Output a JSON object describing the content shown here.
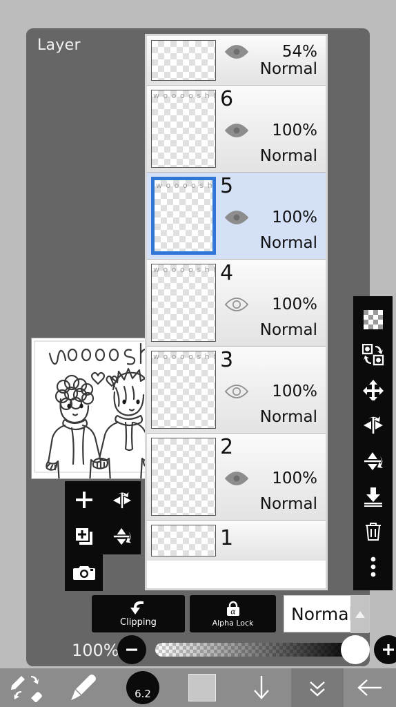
{
  "app": {
    "panel_title": "Layer"
  },
  "artwork": {
    "caption_text": "woooshh",
    "thumb_caption": "w o o o o s h h"
  },
  "layers": [
    {
      "name": "",
      "opacity": "54%",
      "blend": "Normal",
      "visible": true,
      "selected": false,
      "thumb_text": "",
      "partial": "top"
    },
    {
      "name": "6",
      "opacity": "100%",
      "blend": "Normal",
      "visible": true,
      "selected": false,
      "thumb_text": "w o o o o s h h",
      "partial": ""
    },
    {
      "name": "5",
      "opacity": "100%",
      "blend": "Normal",
      "visible": true,
      "selected": true,
      "thumb_text": "w o o o o s h h",
      "partial": ""
    },
    {
      "name": "4",
      "opacity": "100%",
      "blend": "Normal",
      "visible": false,
      "selected": false,
      "thumb_text": "w o o o o s h h",
      "partial": ""
    },
    {
      "name": "3",
      "opacity": "100%",
      "blend": "Normal",
      "visible": false,
      "selected": false,
      "thumb_text": "w o o o o s h h",
      "partial": ""
    },
    {
      "name": "2",
      "opacity": "100%",
      "blend": "Normal",
      "visible": true,
      "selected": false,
      "thumb_text": "",
      "partial": ""
    },
    {
      "name": "1",
      "opacity": "",
      "blend": "",
      "visible": true,
      "selected": false,
      "thumb_text": "",
      "partial": "bottom"
    }
  ],
  "right_toolbar": [
    {
      "icon": "transparency-checker-icon",
      "label": "Transparency"
    },
    {
      "icon": "swap-layers-icon",
      "label": "Swap Layers"
    },
    {
      "icon": "move-icon",
      "label": "Move"
    },
    {
      "icon": "flip-horizontal-icon",
      "label": "Flip Horizontal"
    },
    {
      "icon": "flip-vertical-icon",
      "label": "Flip Vertical"
    },
    {
      "icon": "merge-down-icon",
      "label": "Merge Down"
    },
    {
      "icon": "trash-icon",
      "label": "Delete Layer"
    },
    {
      "icon": "more-options-icon",
      "label": "More"
    }
  ],
  "popup_toolbar": [
    {
      "icon": "add-layer-icon",
      "label": "Add Layer"
    },
    {
      "icon": "flip-horizontal-icon",
      "label": "Flip Horizontal"
    },
    {
      "icon": "duplicate-layer-icon",
      "label": "Duplicate Layer"
    },
    {
      "icon": "flip-vertical-icon",
      "label": "Flip Vertical"
    },
    {
      "icon": "camera-icon",
      "label": "Import Photo"
    }
  ],
  "controls": {
    "clipping_label": "Clipping",
    "alpha_lock_label": "Alpha Lock",
    "blend_mode": "Normal",
    "blend_arrow": "up-arrow-icon"
  },
  "opacity": {
    "value": "100%",
    "minus_label": "−",
    "plus_label": "+"
  },
  "bottom_bar": [
    {
      "icon": "undo-redo-brush-eraser-icon",
      "label": "Tool Switch"
    },
    {
      "icon": "brush-icon",
      "label": "Brush"
    },
    {
      "icon": "brush-size-icon",
      "label": "Brush Size"
    },
    {
      "icon": "color-swatch-icon",
      "label": "Color"
    },
    {
      "icon": "down-arrow-icon",
      "label": "Down"
    },
    {
      "icon": "double-chevron-down-icon",
      "label": "Collapse"
    },
    {
      "icon": "back-arrow-icon",
      "label": "Back"
    }
  ],
  "brush": {
    "size": "6.2"
  },
  "colors": {
    "panel_bg": "#666666",
    "page_bg": "#bcbcbc",
    "canvas_bg": "#8e8e8e",
    "selected_row": "#d3e0f5",
    "selection_border": "#2f76d6",
    "toolbar_bg": "#0b0b0b",
    "bottom_bar_bg": "#8c8c8c",
    "color_swatch": "#c7c7c7"
  }
}
